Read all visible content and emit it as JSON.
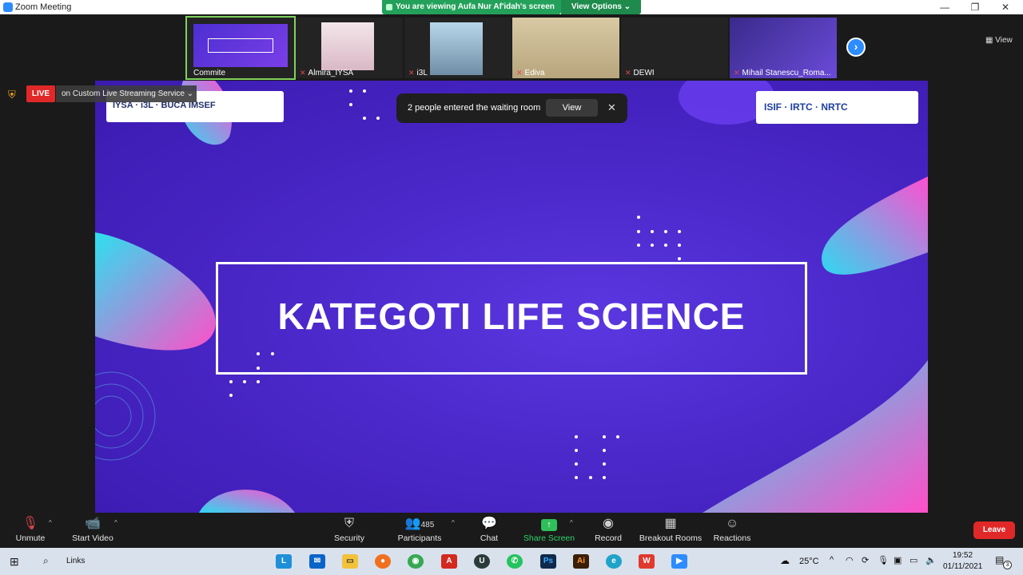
{
  "window": {
    "title": "Zoom Meeting",
    "minimize": "—",
    "restore": "❐",
    "close": "✕"
  },
  "share_banner": {
    "text": "You are viewing Aufa Nur Af'idah's screen",
    "view_options": "View Options ⌄"
  },
  "gallery": {
    "participants": [
      {
        "name": "Commite",
        "mic": ""
      },
      {
        "name": "Almira_IYSA",
        "mic": "✕"
      },
      {
        "name": "i3L",
        "mic": "✕"
      },
      {
        "name": "Ediva",
        "mic": "✕"
      },
      {
        "name": "DEWI",
        "mic": "✕"
      },
      {
        "name": "Mihail Stanescu_Roma...",
        "mic": "✕"
      }
    ],
    "view_label": "View"
  },
  "live": {
    "badge": "LIVE",
    "service": "on Custom Live Streaming Service  ⌄"
  },
  "notification": {
    "message": "2 people entered the waiting room",
    "view": "View",
    "close": "✕"
  },
  "slide": {
    "title": "KATEGOTI LIFE SCIENCE",
    "logos_left": "IYSA · i3L · BUCA IMSEF",
    "logos_right": "ISIF · IRTC · NRTC"
  },
  "toolbar": {
    "unmute": "Unmute",
    "start_video": "Start Video",
    "security": "Security",
    "participants": "Participants",
    "participants_count": "485",
    "chat": "Chat",
    "share_screen": "Share Screen",
    "record": "Record",
    "breakout_rooms": "Breakout Rooms",
    "reactions": "Reactions",
    "leave": "Leave"
  },
  "taskbar": {
    "search_label": "Links",
    "weather": "25°C",
    "time": "19:52",
    "date": "01/11/2021",
    "notification_count": "3"
  },
  "colors": {
    "zoom_blue": "#2d8cff",
    "live_red": "#e02828",
    "share_green": "#23a15a",
    "slide_purple": "#4a27c8"
  }
}
